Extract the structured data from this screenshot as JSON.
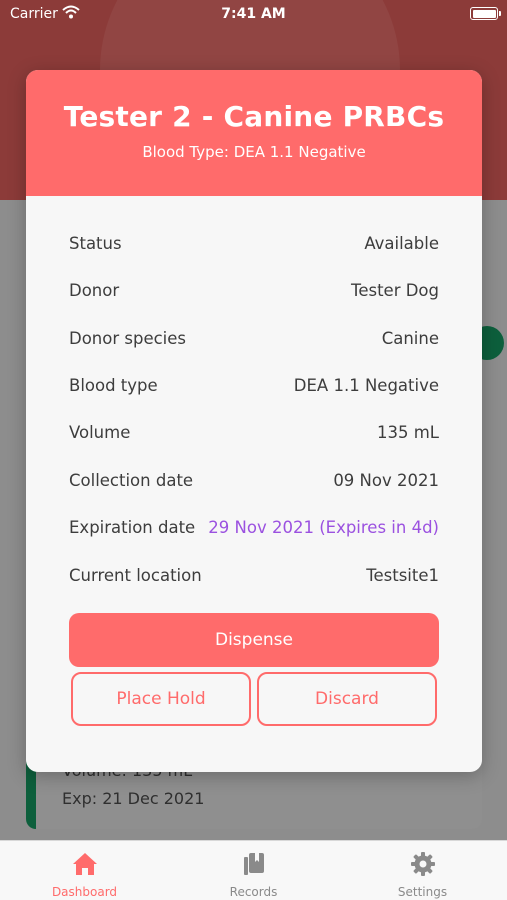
{
  "status_bar": {
    "carrier": "Carrier",
    "time": "7:41 AM"
  },
  "background": {
    "card_lines": [
      "Volume: 135 mL",
      "Exp: 21 Dec 2021"
    ]
  },
  "modal": {
    "title": "Tester 2 - Canine PRBCs",
    "subtitle": "Blood Type: DEA 1.1 Negative",
    "rows": [
      {
        "label": "Status",
        "value": "Available"
      },
      {
        "label": "Donor",
        "value": "Tester Dog"
      },
      {
        "label": "Donor species",
        "value": "Canine"
      },
      {
        "label": "Blood type",
        "value": "DEA 1.1 Negative"
      },
      {
        "label": "Volume",
        "value": "135 mL"
      },
      {
        "label": "Collection date",
        "value": "09 Nov 2021"
      },
      {
        "label": "Expiration date",
        "value": "29 Nov 2021 (Expires in 4d)"
      },
      {
        "label": "Current location",
        "value": "Testsite1"
      }
    ],
    "buttons": {
      "dispense": "Dispense",
      "place_hold": "Place Hold",
      "discard": "Discard"
    }
  },
  "tabbar": {
    "tabs": [
      {
        "label": "Dashboard",
        "icon": "home-icon",
        "active": true
      },
      {
        "label": "Records",
        "icon": "book-icon",
        "active": false
      },
      {
        "label": "Settings",
        "icon": "gear-icon",
        "active": false
      }
    ]
  },
  "colors": {
    "accent": "#ff6b6b",
    "expiry": "#9b51e0",
    "header_dim": "#8c3b39"
  }
}
